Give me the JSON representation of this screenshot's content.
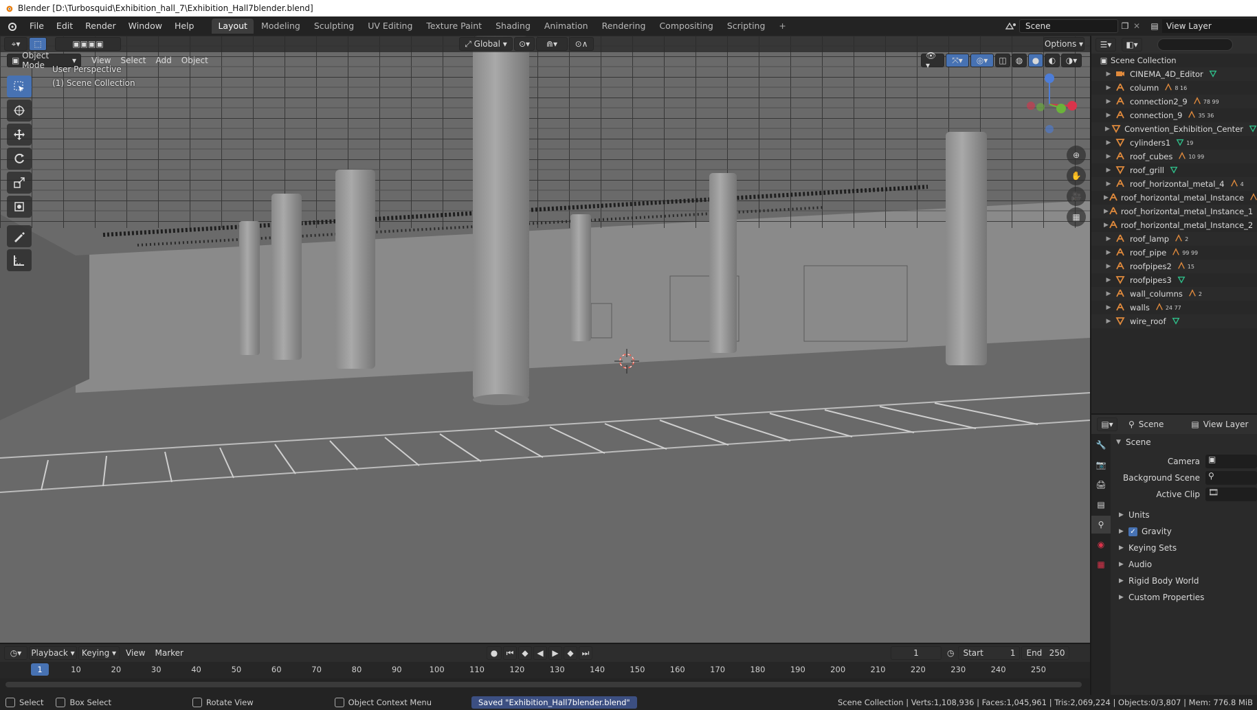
{
  "window": {
    "title": "Blender [D:\\Turbosquid\\Exhibition_hall_7\\Exhibition_Hall7blender.blend]"
  },
  "topbar": {
    "menus": [
      "File",
      "Edit",
      "Render",
      "Window",
      "Help"
    ],
    "workspaces": [
      "Layout",
      "Modeling",
      "Sculpting",
      "UV Editing",
      "Texture Paint",
      "Shading",
      "Animation",
      "Rendering",
      "Compositing",
      "Scripting"
    ],
    "active_workspace": "Layout",
    "add_tab": "+",
    "scene": "Scene",
    "view_layer": "View Layer"
  },
  "viewport": {
    "transform_orientation": "Global",
    "options_label": "Options",
    "mode": "Object Mode",
    "menus": [
      "View",
      "Select",
      "Add",
      "Object"
    ],
    "perspective": "User Perspective",
    "collection": "(1) Scene Collection"
  },
  "outliner": {
    "root": "Scene Collection",
    "items": [
      {
        "name": "CINEMA_4D_Editor",
        "type": "camera"
      },
      {
        "name": "column",
        "type": "empty",
        "badges": "8 16"
      },
      {
        "name": "connection2_9",
        "type": "empty",
        "badges": "78 99"
      },
      {
        "name": "connection_9",
        "type": "empty",
        "badges": "35 36"
      },
      {
        "name": "Convention_Exhibition_Center",
        "type": "mesh"
      },
      {
        "name": "cylinders1",
        "type": "mesh",
        "badges": "19"
      },
      {
        "name": "roof_cubes",
        "type": "empty",
        "badges": "10 99"
      },
      {
        "name": "roof_grill",
        "type": "mesh"
      },
      {
        "name": "roof_horizontal_metal_4",
        "type": "empty",
        "badges": "4"
      },
      {
        "name": "roof_horizontal_metal_Instance",
        "type": "empty"
      },
      {
        "name": "roof_horizontal_metal_Instance_1",
        "type": "empty"
      },
      {
        "name": "roof_horizontal_metal_Instance_2",
        "type": "empty"
      },
      {
        "name": "roof_lamp",
        "type": "empty",
        "badges": "2"
      },
      {
        "name": "roof_pipe",
        "type": "empty",
        "badges": "99 99"
      },
      {
        "name": "roofpipes2",
        "type": "empty",
        "badges": "15"
      },
      {
        "name": "roofpipes3",
        "type": "mesh"
      },
      {
        "name": "wall_columns",
        "type": "empty",
        "badges": "2"
      },
      {
        "name": "walls",
        "type": "empty",
        "badges": "24 77"
      },
      {
        "name": "wire_roof",
        "type": "mesh"
      }
    ]
  },
  "properties": {
    "scene_tab": "Scene",
    "view_layer_tab": "View Layer",
    "panel_title": "Scene",
    "fields": [
      {
        "label": "Camera"
      },
      {
        "label": "Background Scene"
      },
      {
        "label": "Active Clip"
      }
    ],
    "sections": [
      "Units",
      "Gravity",
      "Keying Sets",
      "Audio",
      "Rigid Body World",
      "Custom Properties"
    ],
    "gravity_checked": true
  },
  "timeline": {
    "menus": [
      "Playback",
      "Keying",
      "View",
      "Marker"
    ],
    "current_frame": "1",
    "start_label": "Start",
    "start": "1",
    "end_label": "End",
    "end": "250",
    "ticks": [
      "10",
      "20",
      "30",
      "40",
      "50",
      "60",
      "70",
      "80",
      "90",
      "100",
      "110",
      "120",
      "130",
      "140",
      "150",
      "160",
      "170",
      "180",
      "190",
      "200",
      "210",
      "220",
      "230",
      "240",
      "250"
    ]
  },
  "statusbar": {
    "select": "Select",
    "box_select": "Box Select",
    "rotate_view": "Rotate View",
    "context_menu": "Object Context Menu",
    "saved": "Saved \"Exhibition_Hall7blender.blend\"",
    "stats": "Scene Collection | Verts:1,108,936 | Faces:1,045,961 | Tris:2,069,224 | Objects:0/3,807 | Mem: 776.8 MiB"
  },
  "colors": {
    "accent": "#4772b3",
    "empty_icon": "#e08a3c",
    "mesh_icon": "#e08a3c",
    "material_icon": "#2fbf8a"
  }
}
